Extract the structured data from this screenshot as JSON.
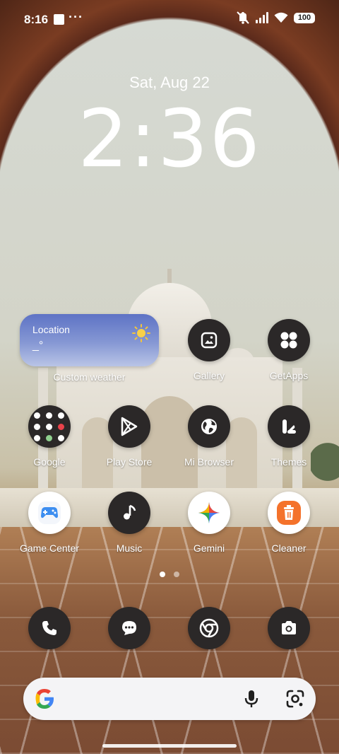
{
  "status_bar": {
    "time": "8:16",
    "overflow": "···",
    "battery": "100"
  },
  "lockclock": {
    "date": "Sat, Aug 22",
    "time": "2:36"
  },
  "weather_widget": {
    "location": "Location",
    "temp": "_°",
    "label": "Custom weather"
  },
  "apps": [
    {
      "label": "Gallery",
      "icon": "gallery-icon"
    },
    {
      "label": "GetApps",
      "icon": "getapps-icon"
    },
    {
      "label": "Google",
      "icon": "google-folder-icon"
    },
    {
      "label": "Play Store",
      "icon": "play-store-icon"
    },
    {
      "label": "Mi Browser",
      "icon": "globe-icon"
    },
    {
      "label": "Themes",
      "icon": "themes-icon"
    },
    {
      "label": "Game Center",
      "icon": "gamepad-icon"
    },
    {
      "label": "Music",
      "icon": "music-note-icon"
    },
    {
      "label": "Gemini",
      "icon": "gemini-icon"
    },
    {
      "label": "Cleaner",
      "icon": "trash-icon"
    }
  ],
  "dock": [
    {
      "icon": "phone-icon"
    },
    {
      "icon": "messages-icon"
    },
    {
      "icon": "chrome-icon"
    },
    {
      "icon": "camera-icon"
    }
  ],
  "page_indicator": {
    "pages": 2,
    "active": 1
  }
}
